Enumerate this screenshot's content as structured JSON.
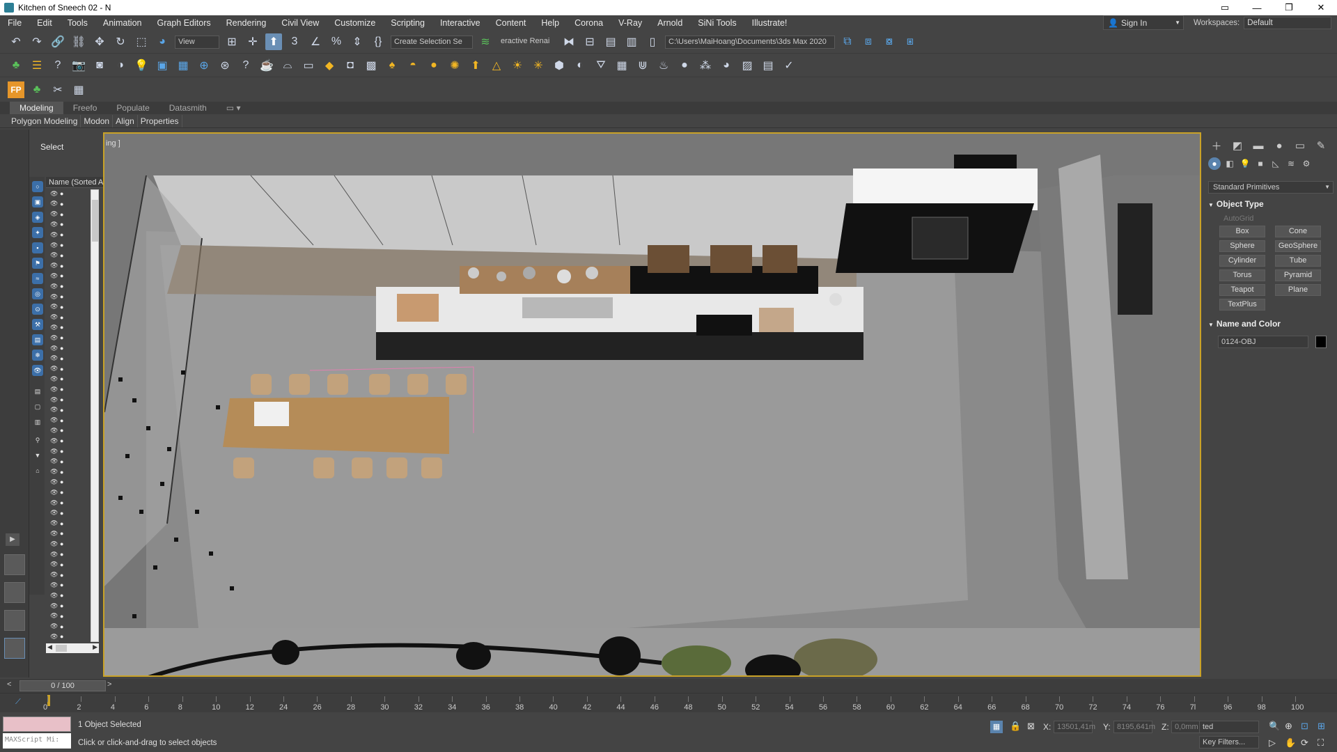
{
  "window": {
    "title": "Kitchen of Sneech 02 - N",
    "controls": [
      "▭",
      "—",
      "❐",
      "✕"
    ]
  },
  "menubar": {
    "items": [
      "File",
      "Edit",
      "Tools",
      "Animation",
      "Graph Editors",
      "Rendering",
      "Civil View",
      "Customize",
      "Scripting",
      "Interactive",
      "Content",
      "Help",
      "Corona",
      "V-Ray",
      "Arnold",
      "SiNi Tools",
      "Illustrate!"
    ],
    "sign_in": "Sign In",
    "workspaces_label": "Workspaces:",
    "workspaces_value": "Default"
  },
  "toolbar": {
    "view_dropdown": "View",
    "selection_set": "Create Selection Se",
    "interactive_render": "eractive Renai",
    "project_path": "C:\\Users\\MaiHoang\\Documents\\3ds Max 2020"
  },
  "ribbon": {
    "tabs": [
      "Modeling",
      "Freefo",
      "Populate",
      "Datasmith"
    ],
    "active_tab": "Modeling",
    "subtabs": [
      "Polygon Modeling",
      "Modon",
      "Align",
      "Properties"
    ]
  },
  "explorer": {
    "title": "Select",
    "column_header": "Name (Sorted A"
  },
  "viewport": {
    "label": "ing ]"
  },
  "command_panel": {
    "category": "Standard Primitives",
    "object_type_title": "Object Type",
    "autogrid": "AutoGrid",
    "primitives": [
      "Box",
      "Cone",
      "Sphere",
      "GeoSphere",
      "Cylinder",
      "Tube",
      "Torus",
      "Pyramid",
      "Teapot",
      "Plane",
      "TextPlus"
    ],
    "name_color_title": "Name and Color",
    "object_name": "0124-OBJ",
    "object_color": "#000000"
  },
  "timeline": {
    "frame_display": "0 / 100",
    "ticks": [
      "0",
      "2",
      "4",
      "6",
      "8",
      "10",
      "12",
      "24",
      "26",
      "28",
      "30",
      "32",
      "34",
      "36",
      "38",
      "40",
      "42",
      "44",
      "46",
      "48",
      "50",
      "52",
      "54",
      "56",
      "58",
      "60",
      "62",
      "64",
      "66",
      "68",
      "70",
      "72",
      "74",
      "76",
      "7l",
      "96",
      "98",
      "100"
    ]
  },
  "status": {
    "maxscript_placeholder": "MAXScript Mi:",
    "selection_info": "1 Object Selected",
    "hint": "Click or click-and-drag to select objects",
    "x_label": "X:",
    "x_value": "13501,41m",
    "y_label": "Y:",
    "y_value": "8195,641m",
    "z_label": "Z:",
    "z_value": "0,0mm",
    "selected_dropdown": "ted",
    "key_filters": "Key Filters..."
  }
}
